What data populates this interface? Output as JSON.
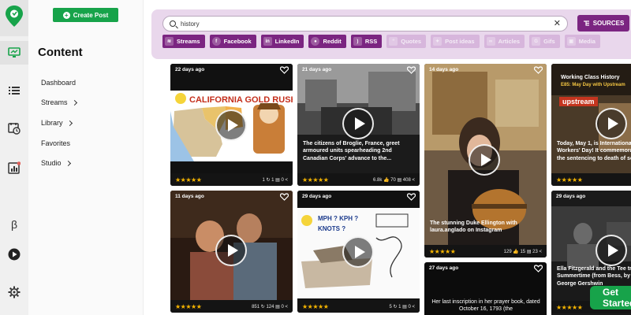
{
  "sidebar": {
    "rail_icons": [
      "logo-pin-icon",
      "content-screen-icon",
      "list-icon",
      "calendar-clock-icon",
      "analytics-chart-icon",
      "beta-icon",
      "video-play-icon",
      "settings-gear-icon"
    ],
    "beta_label": "β",
    "create_post_label": "Create Post",
    "section_title": "Content",
    "items": [
      {
        "label": "Dashboard",
        "has_chevron": false
      },
      {
        "label": "Streams",
        "has_chevron": true
      },
      {
        "label": "Library",
        "has_chevron": true
      },
      {
        "label": "Favorites",
        "has_chevron": false
      },
      {
        "label": "Studio",
        "has_chevron": true
      }
    ]
  },
  "search": {
    "value": "history",
    "clear_icon": "✕"
  },
  "sources_label": "SOURCES",
  "filters": [
    {
      "label": "Streams",
      "active": true,
      "icon": "streams-icon"
    },
    {
      "label": "Facebook",
      "active": true,
      "icon": "facebook-icon"
    },
    {
      "label": "LinkedIn",
      "active": true,
      "icon": "linkedin-icon"
    },
    {
      "label": "Reddit",
      "active": true,
      "icon": "reddit-icon"
    },
    {
      "label": "RSS",
      "active": true,
      "icon": "rss-icon"
    },
    {
      "label": "Quotes",
      "active": false,
      "icon": "quote-icon"
    },
    {
      "label": "Post ideas",
      "active": false,
      "icon": "lightbulb-icon"
    },
    {
      "label": "Articles",
      "active": false,
      "icon": "link-icon"
    },
    {
      "label": "Gifs",
      "active": false,
      "icon": "gif-icon"
    },
    {
      "label": "Media",
      "active": false,
      "icon": "image-icon"
    }
  ],
  "cards": [
    {
      "age": "22 days ago",
      "thumb_title": "CALIFORNIA GOLD RUSH",
      "caption": "",
      "stars": "★★★★★",
      "metrics": "1 ↻  1 ▤  0 <"
    },
    {
      "age": "21 days ago",
      "thumb_title": "",
      "caption": "The citizens of Broglie, France, greet armoured units spearheading 2nd Canadian Corps' advance to the...",
      "stars": "★★★★★",
      "metrics": "6.8k 👍  70 ▤  408 <"
    },
    {
      "age": "14 days ago",
      "thumb_title": "",
      "caption": "The stunning Duke Ellington with laura.anglado on Instagram",
      "stars": "★★★★★",
      "metrics": "129 👍  15 ▤  23 <"
    },
    {
      "age": "",
      "thumb_title": "Working Class History",
      "thumb_subtitle": "E85: May Day with Upstream",
      "thumb_brand": "upstream",
      "caption": "Today, May 1, is International Workers' Day! It commemorates the sentencing to death of seven...",
      "stars": "★★★★★",
      "metrics": ""
    },
    {
      "age": "11 days ago",
      "thumb_title": "",
      "caption": "",
      "stars": "★★★★★",
      "metrics": "851 ↻  124 ▤  0 <"
    },
    {
      "age": "29 days ago",
      "thumb_title": "MPH ? KPH ? KNOTS ?",
      "caption": "",
      "stars": "★★★★★",
      "metrics": "5 ↻  1 ▤  0 <"
    },
    {
      "age": "27 days ago",
      "thumb_title": "",
      "caption": "Her last inscription in her prayer book, dated October 16, 1793 (the",
      "stars": "",
      "metrics": ""
    },
    {
      "age": "29 days ago",
      "thumb_title": "",
      "caption": "Ella Fitzgerald and the Tee trio - Summertime (from Bess, by George Gershwin",
      "stars": "★★★★★",
      "metrics": ""
    }
  ],
  "get_started_label": "Get Started",
  "colors": {
    "brand_green": "#17a34a",
    "accent_purple": "#7b2581",
    "filter_bg": "#e9d7ec",
    "star": "#f5b400"
  }
}
